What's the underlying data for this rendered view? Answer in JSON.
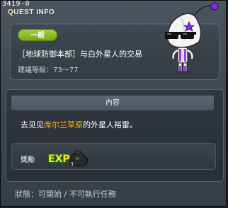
{
  "window": {
    "quest_id": "3419-0",
    "title": "QUEST INFO"
  },
  "header": {
    "category": "一般",
    "quest_name": "［地球防御本部］与白外星人的交易",
    "level_label": "建議等級：",
    "level_range": "73～77"
  },
  "npc": {
    "icon": "white-alien-npc"
  },
  "content": {
    "section_title": "內容",
    "description_before": "去见见",
    "description_highlight": "库尔兰草原",
    "description_after": "的外星人裕雷。"
  },
  "reward": {
    "label": "獎勵",
    "exp_text": "EXP",
    "exp_count": "3",
    "icon": "exp-bag-icon"
  },
  "status": {
    "label": "狀態：",
    "value": "可開始 / 不可執行任務"
  },
  "colors": {
    "badge_green": "#8fbf2a",
    "highlight": "#ffb400",
    "exp_yellow": "#ffe020",
    "exp_green": "#3aa82e"
  }
}
